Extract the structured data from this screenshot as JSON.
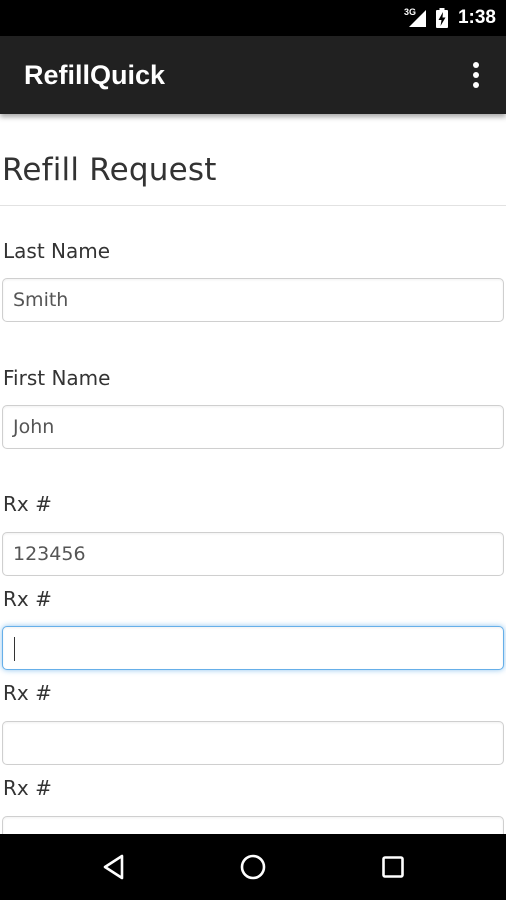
{
  "status_bar": {
    "network": "3G",
    "time": "1:38"
  },
  "app_bar": {
    "title": "RefillQuick",
    "overflow_icon": "more-vert-icon"
  },
  "form": {
    "title": "Refill Request",
    "fields": [
      {
        "label": "Last Name",
        "value": "Smith"
      },
      {
        "label": "First Name",
        "value": "John"
      },
      {
        "label": "Rx #",
        "value": "123456"
      },
      {
        "label": "Rx #",
        "value": ""
      },
      {
        "label": "Rx #",
        "value": ""
      },
      {
        "label": "Rx #",
        "value": ""
      }
    ]
  },
  "nav_bar": {
    "back_icon": "back-triangle-icon",
    "home_icon": "home-circle-icon",
    "recents_icon": "recents-square-icon"
  },
  "colors": {
    "status_bar": "#000000",
    "app_bar": "#212121",
    "focus_border": "#66afe9",
    "text": "#333333"
  }
}
